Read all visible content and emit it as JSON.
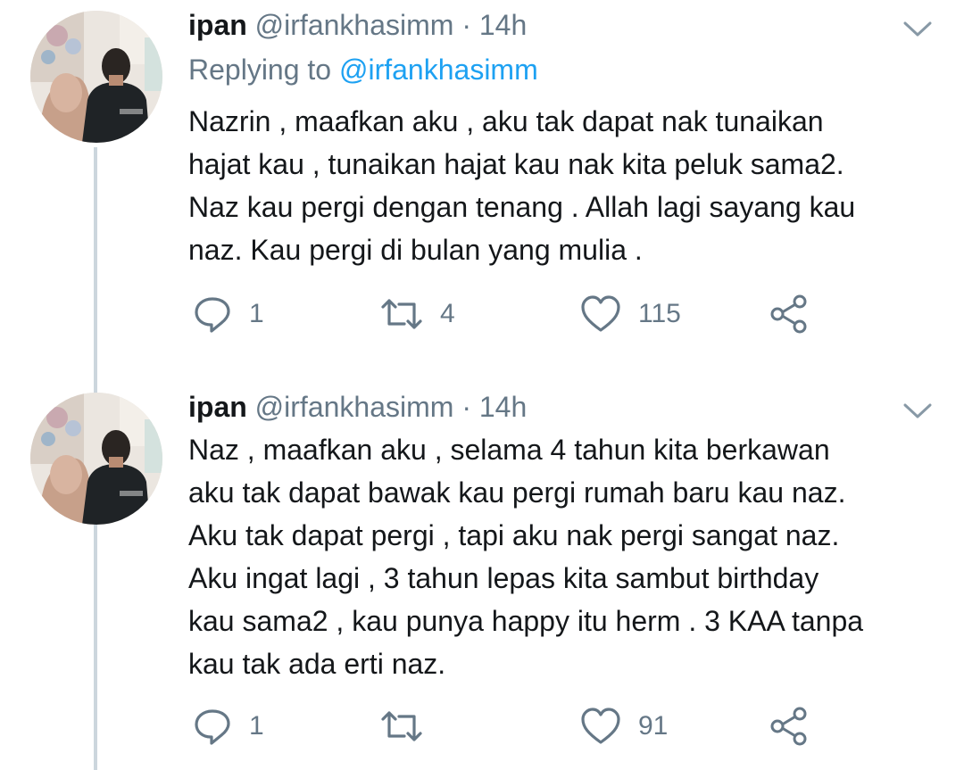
{
  "tweets": [
    {
      "user": {
        "name": "ipan",
        "handle": "@irfankhasimm"
      },
      "separator": "·",
      "time": "14h",
      "reply_prefix": "Replying to ",
      "reply_to": "@irfankhasimm",
      "lines": [
        "Nazrin , maafkan aku , aku tak dapat nak tunaikan",
        "hajat kau , tunaikan hajat kau nak kita peluk sama2.",
        "Naz kau pergi dengan tenang . Allah lagi sayang kau",
        "naz. Kau pergi di bulan yang mulia ."
      ],
      "actions": {
        "replies": "1",
        "retweets": "4",
        "likes": "115"
      }
    },
    {
      "user": {
        "name": "ipan",
        "handle": "@irfankhasimm"
      },
      "separator": "·",
      "time": "14h",
      "lines": [
        "Naz , maafkan aku , selama 4 tahun kita berkawan",
        "aku tak dapat bawak kau pergi rumah baru kau naz.",
        "Aku tak dapat pergi , tapi aku nak pergi sangat naz.",
        "Aku ingat lagi , 3 tahun lepas kita sambut birthday",
        "kau sama2 , kau punya happy itu herm . 3 KAA tanpa",
        "kau tak ada erti naz."
      ],
      "actions": {
        "replies": "1",
        "retweets": "",
        "likes": "91"
      }
    }
  ],
  "icons": {
    "reply": "reply-icon",
    "retweet": "retweet-icon",
    "like": "heart-icon",
    "share": "share-icon",
    "menu": "chevron-down-icon"
  },
  "colors": {
    "text": "#14171a",
    "secondary": "#657786",
    "link": "#1da1f2",
    "thread_line": "#ccd6dd"
  }
}
